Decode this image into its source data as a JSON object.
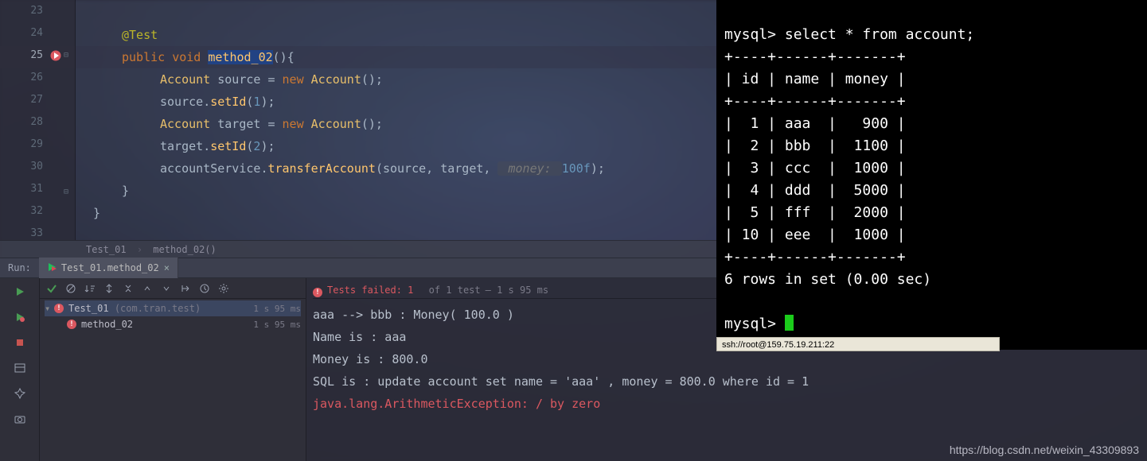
{
  "editor": {
    "line_numbers": [
      "23",
      "24",
      "25",
      "26",
      "27",
      "28",
      "29",
      "30",
      "31",
      "32",
      "33"
    ],
    "current_line_index": 2,
    "tokens": {
      "l24_ann": "@Test",
      "l25_kw1": "public",
      "l25_kw2": "void",
      "l25_method": "method_02",
      "l25_rest": "(){",
      "l26_type": "Account",
      "l26_var": "source",
      "l26_eq": " = ",
      "l26_kw": "new",
      "l26_type2": "Account",
      "l26_end": "();",
      "l27_var": "source",
      "l27_dot": ".",
      "l27_m": "setId",
      "l27_open": "(",
      "l27_num": "1",
      "l27_close": ");",
      "l28_type": "Account",
      "l28_var": "target",
      "l28_eq": " = ",
      "l28_kw": "new",
      "l28_type2": "Account",
      "l28_end": "();",
      "l29_var": "target",
      "l29_dot": ".",
      "l29_m": "setId",
      "l29_open": "(",
      "l29_num": "2",
      "l29_close": ");",
      "l30_var": "accountService",
      "l30_dot": ".",
      "l30_m": "transferAccount",
      "l30_open": "(",
      "l30_a1": "source",
      "l30_c1": ", ",
      "l30_a2": "target",
      "l30_c2": ", ",
      "l30_hint": " money: ",
      "l30_num": "100f",
      "l30_close": ");",
      "l31": "}",
      "l32": "}"
    }
  },
  "breadcrumb": {
    "a": "Test_01",
    "b": "method_02()"
  },
  "run_tab": {
    "run_label": "Run:",
    "tab_name": "Test_01.method_02"
  },
  "run_status": {
    "text": "Tests failed: 1",
    "of": "of 1 test",
    "time": " – 1 s 95 ms"
  },
  "tree": {
    "root_name": "Test_01",
    "root_pkg": "(com.tran.test)",
    "root_time": "1 s 95 ms",
    "child_name": "method_02",
    "child_time": "1 s 95 ms"
  },
  "console": {
    "l1": "aaa --> bbb : Money( 100.0 )",
    "l2": "Name is : aaa",
    "l3": "Money is : 800.0",
    "l4": "SQL is : update account set name = 'aaa' , money = 800.0 where id = 1",
    "l5": "",
    "l6": "java.lang.ArithmeticException: / by zero"
  },
  "terminal": {
    "prompt": "mysql> ",
    "query": "select * from account;",
    "border_top": "+----+------+-------+",
    "header": "| id | name | money |",
    "rows": [
      "|  1 | aaa  |   900 |",
      "|  2 | bbb  |  1100 |",
      "|  3 | ccc  |  1000 |",
      "|  4 | ddd  |  5000 |",
      "|  5 | fff  |  2000 |",
      "| 10 | eee  |  1000 |"
    ],
    "footer": "6 rows in set (0.00 sec)",
    "prompt2": "mysql> "
  },
  "ssh": {
    "text": "ssh://root@159.75.19.211:22"
  },
  "watermark": {
    "text": "https://blog.csdn.net/weixin_43309893"
  },
  "chart_data": {
    "type": "table",
    "title": "account",
    "columns": [
      "id",
      "name",
      "money"
    ],
    "rows": [
      {
        "id": 1,
        "name": "aaa",
        "money": 900
      },
      {
        "id": 2,
        "name": "bbb",
        "money": 1100
      },
      {
        "id": 3,
        "name": "ccc",
        "money": 1000
      },
      {
        "id": 4,
        "name": "ddd",
        "money": 5000
      },
      {
        "id": 5,
        "name": "fff",
        "money": 2000
      },
      {
        "id": 10,
        "name": "eee",
        "money": 1000
      }
    ],
    "row_count": 6,
    "elapsed_sec": 0.0
  }
}
